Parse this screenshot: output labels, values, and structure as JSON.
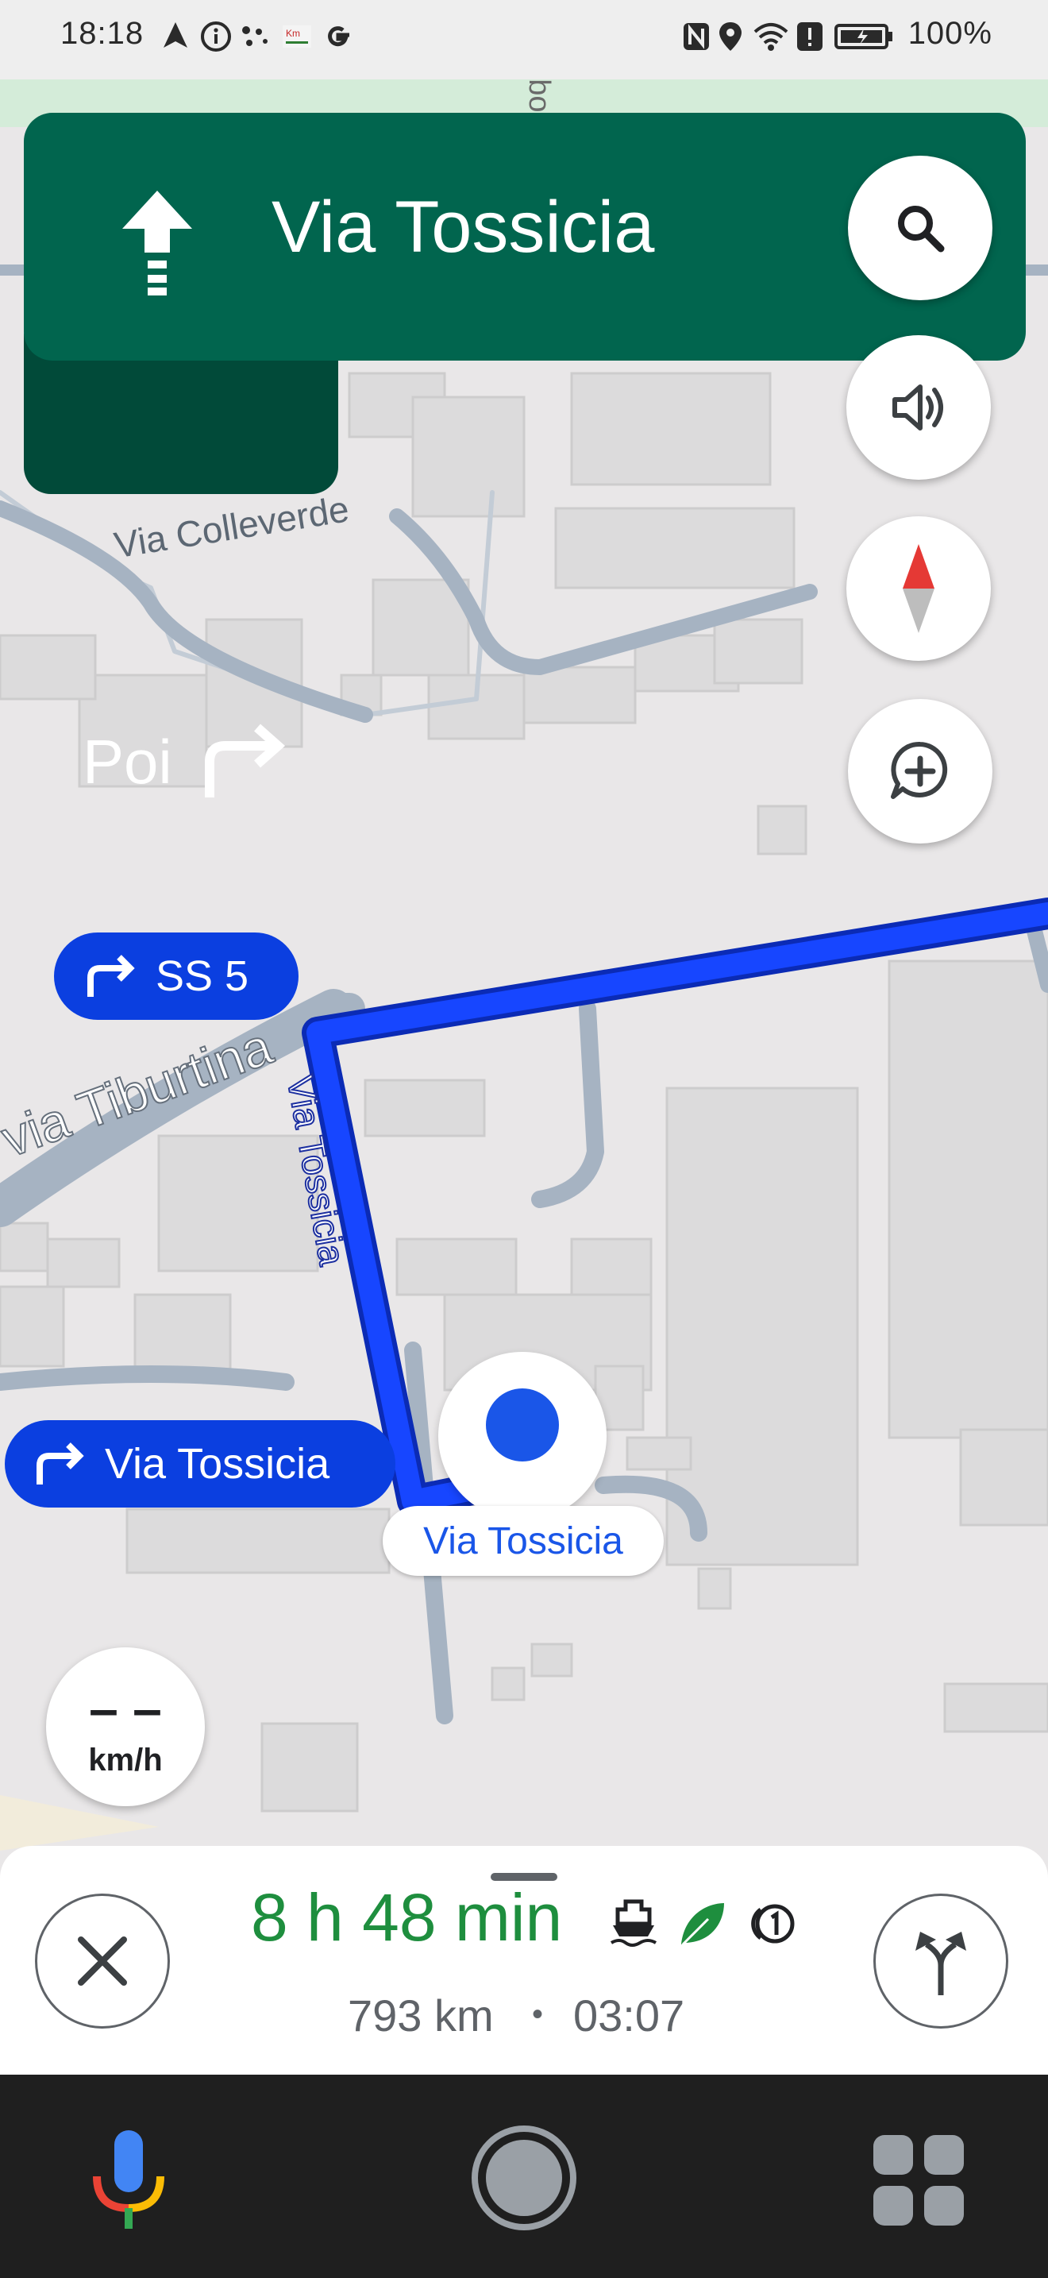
{
  "status_bar": {
    "time": "18:18",
    "battery": "100%"
  },
  "navigation": {
    "current_street": "Via Tossicia",
    "then_label": "Poi"
  },
  "map": {
    "labels": {
      "via_colleverde": "Via Colleverde",
      "via_tiburtina": "via Tiburtina",
      "via_tossicia_road": "Via Tossicia",
      "current_location": "Via Tossicia",
      "top_partial": "Capalbo"
    },
    "route_pills": {
      "ss5": "SS 5",
      "via_tossicia": "Via Tossicia"
    }
  },
  "speed": {
    "value": "– –",
    "unit": "km/h"
  },
  "trip": {
    "eta": "8 h 48 min",
    "distance": "793 km",
    "separator": "•",
    "arrival": "03:07"
  },
  "colors": {
    "banner": "#01654e",
    "banner_secondary": "#014a39",
    "route": "#0b3fe0",
    "eta": "#1e8e3e"
  }
}
